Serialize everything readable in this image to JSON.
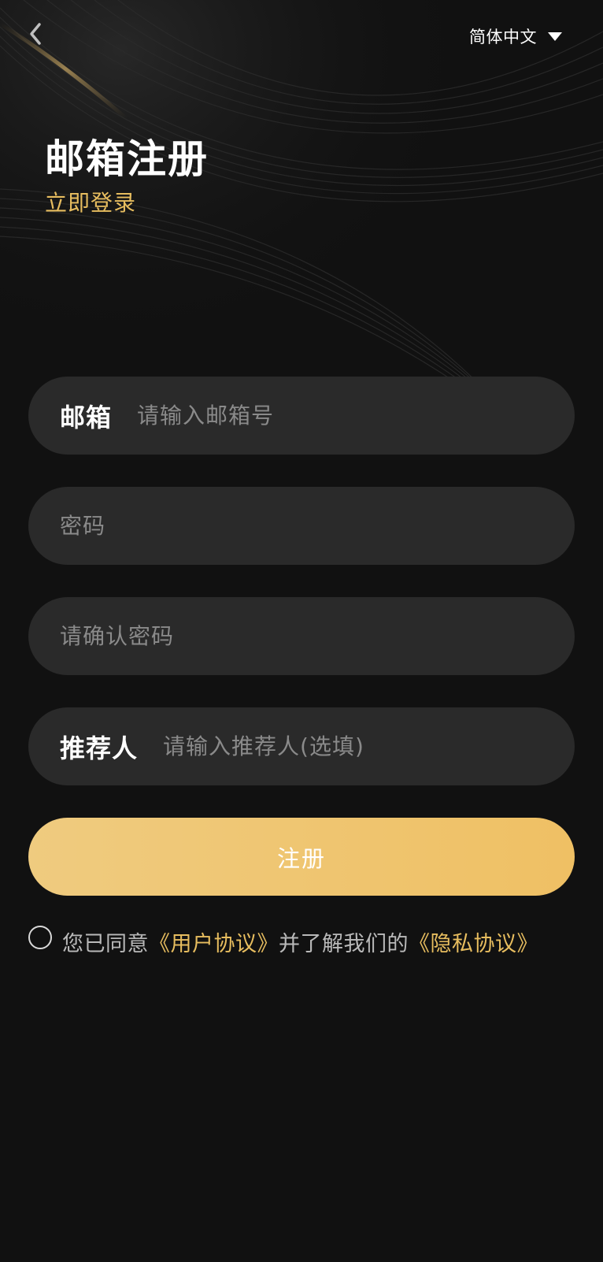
{
  "header": {
    "language": "简体中文",
    "back_icon": "chevron-left-icon",
    "caret_icon": "caret-down-icon"
  },
  "title": "邮箱注册",
  "login_link": "立即登录",
  "form": {
    "email": {
      "label": "邮箱",
      "placeholder": "请输入邮箱号",
      "value": ""
    },
    "password": {
      "placeholder": "密码",
      "value": ""
    },
    "confirm_password": {
      "placeholder": "请确认密码",
      "value": ""
    },
    "referrer": {
      "label": "推荐人",
      "placeholder": "请输入推荐人(选填)",
      "value": ""
    },
    "submit_label": "注册"
  },
  "agreement": {
    "checked": false,
    "prefix": "您已同意",
    "user_agreement": "《用户协议》",
    "middle": "并了解我们的",
    "privacy_agreement": "《隐私协议》"
  },
  "colors": {
    "background": "#111111",
    "field_bg": "#2a2a2a",
    "accent_gold": "#e7bd5f",
    "button_gradient_start": "#efcb7f",
    "button_gradient_end": "#efc064",
    "placeholder": "#8a8a8a"
  }
}
